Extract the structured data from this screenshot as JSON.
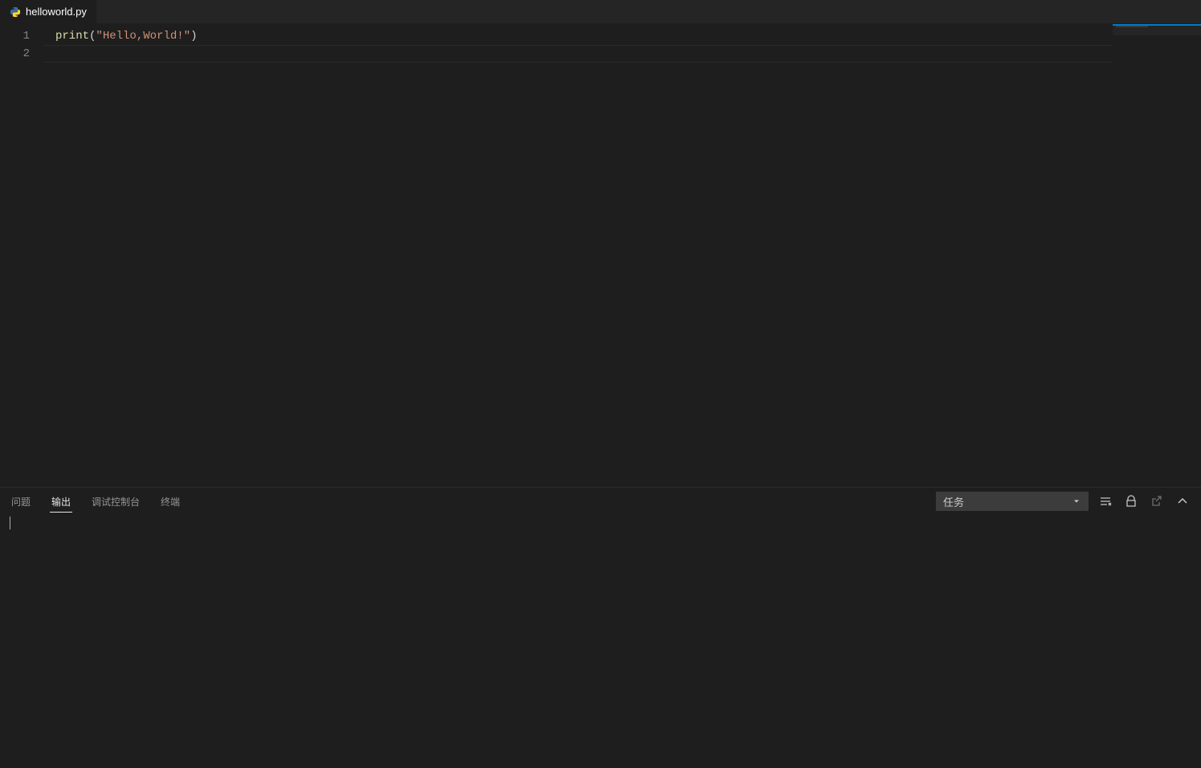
{
  "tab": {
    "filename": "helloworld.py",
    "icon": "python-icon"
  },
  "editor": {
    "lines": [
      {
        "num": "1",
        "fn": "print",
        "open": "(",
        "quote1": "\"",
        "str": "Hello,World!",
        "quote2": "\"",
        "close": ")"
      },
      {
        "num": "2"
      }
    ],
    "active_line_index": 1
  },
  "panel": {
    "tabs": {
      "problems": "问题",
      "output": "输出",
      "debug_console": "调试控制台",
      "terminal": "终端"
    },
    "active_tab": "output",
    "select_value": "任务",
    "output_text": ""
  }
}
